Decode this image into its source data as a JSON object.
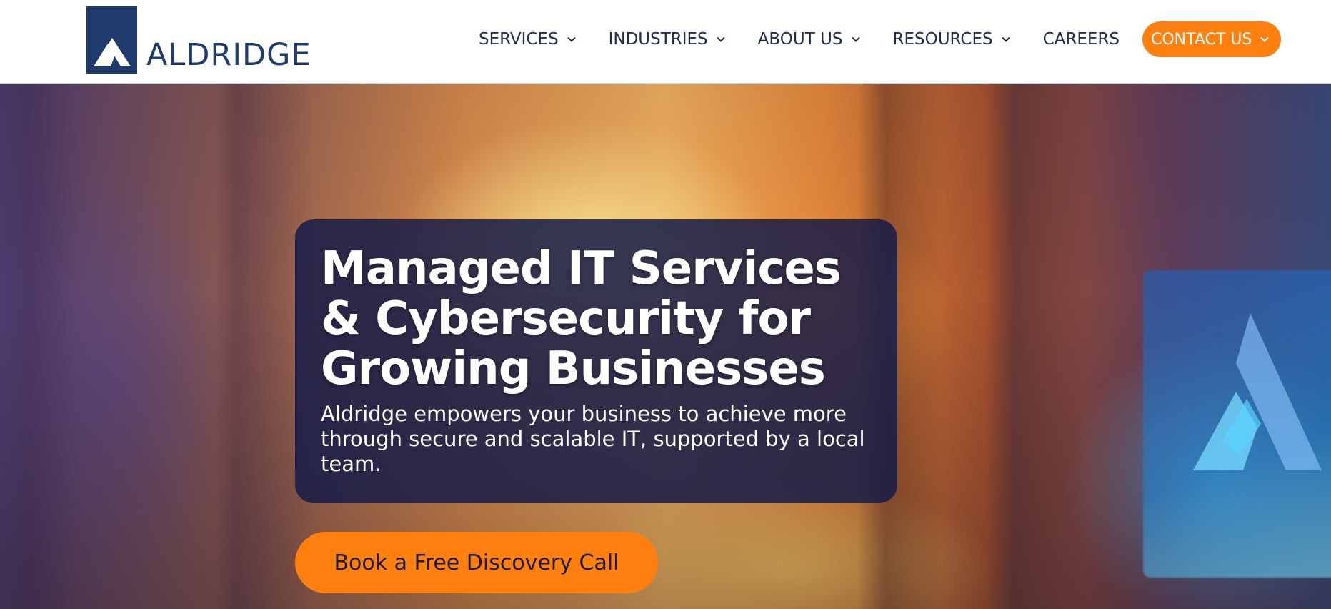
{
  "brand": {
    "name": "ALDRIDGE",
    "primary_color": "#1f3a6d",
    "accent_color": "#ff7f0f"
  },
  "nav": {
    "items": [
      {
        "label": "SERVICES",
        "icon": "chevron-down-icon"
      },
      {
        "label": "INDUSTRIES",
        "icon": "chevron-down-icon"
      },
      {
        "label": "ABOUT US",
        "icon": "chevron-down-icon"
      },
      {
        "label": "RESOURCES",
        "icon": "chevron-down-icon"
      },
      {
        "label": "CAREERS"
      }
    ],
    "contact": {
      "label": "CONTACT US",
      "icon": "chevron-down-icon"
    }
  },
  "hero": {
    "title_line1": "Managed IT Services",
    "title_line2": "& Cybersecurity for",
    "title_line3": "Growing Businesses",
    "subtitle": "Aldridge empowers your business to achieve more through secure and scalable IT, supported by a local team.",
    "cta_label": "Book a Free Discovery Call"
  }
}
